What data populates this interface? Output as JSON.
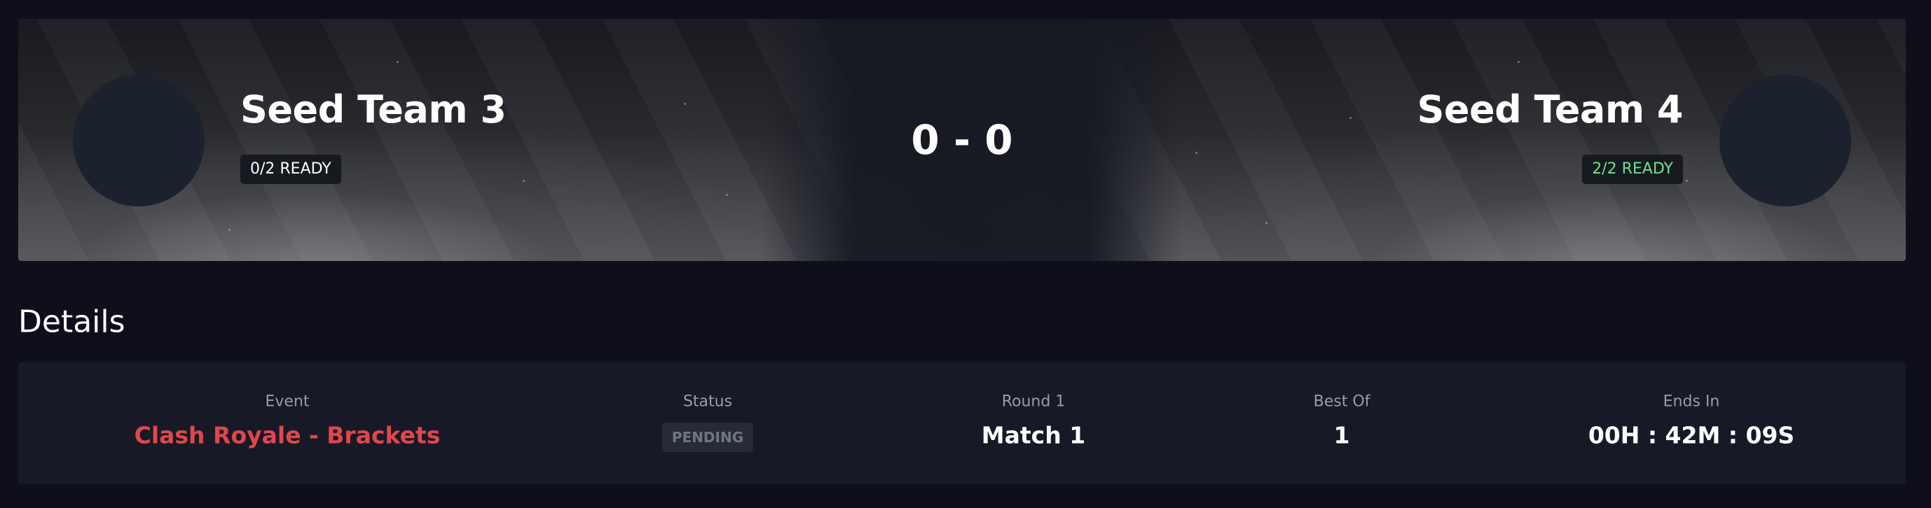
{
  "match": {
    "team1": {
      "name": "Seed Team 3",
      "ready_status": "0/2 READY"
    },
    "team2": {
      "name": "Seed Team 4",
      "ready_status": "2/2 READY"
    },
    "score": "0 - 0"
  },
  "details": {
    "title": "Details",
    "event": {
      "label": "Event",
      "value": "Clash Royale - Brackets"
    },
    "status": {
      "label": "Status",
      "value": "PENDING"
    },
    "round": {
      "label": "Round 1",
      "value": "Match 1"
    },
    "best_of": {
      "label": "Best Of",
      "value": "1"
    },
    "ends_in": {
      "label": "Ends In",
      "value": "00H : 42M : 09S"
    }
  },
  "colors": {
    "background": "#0e0f1a",
    "card": "#171a26",
    "event_accent": "#e0474b",
    "ready_green": "#6fe08f",
    "status_muted": "#6f7583"
  }
}
